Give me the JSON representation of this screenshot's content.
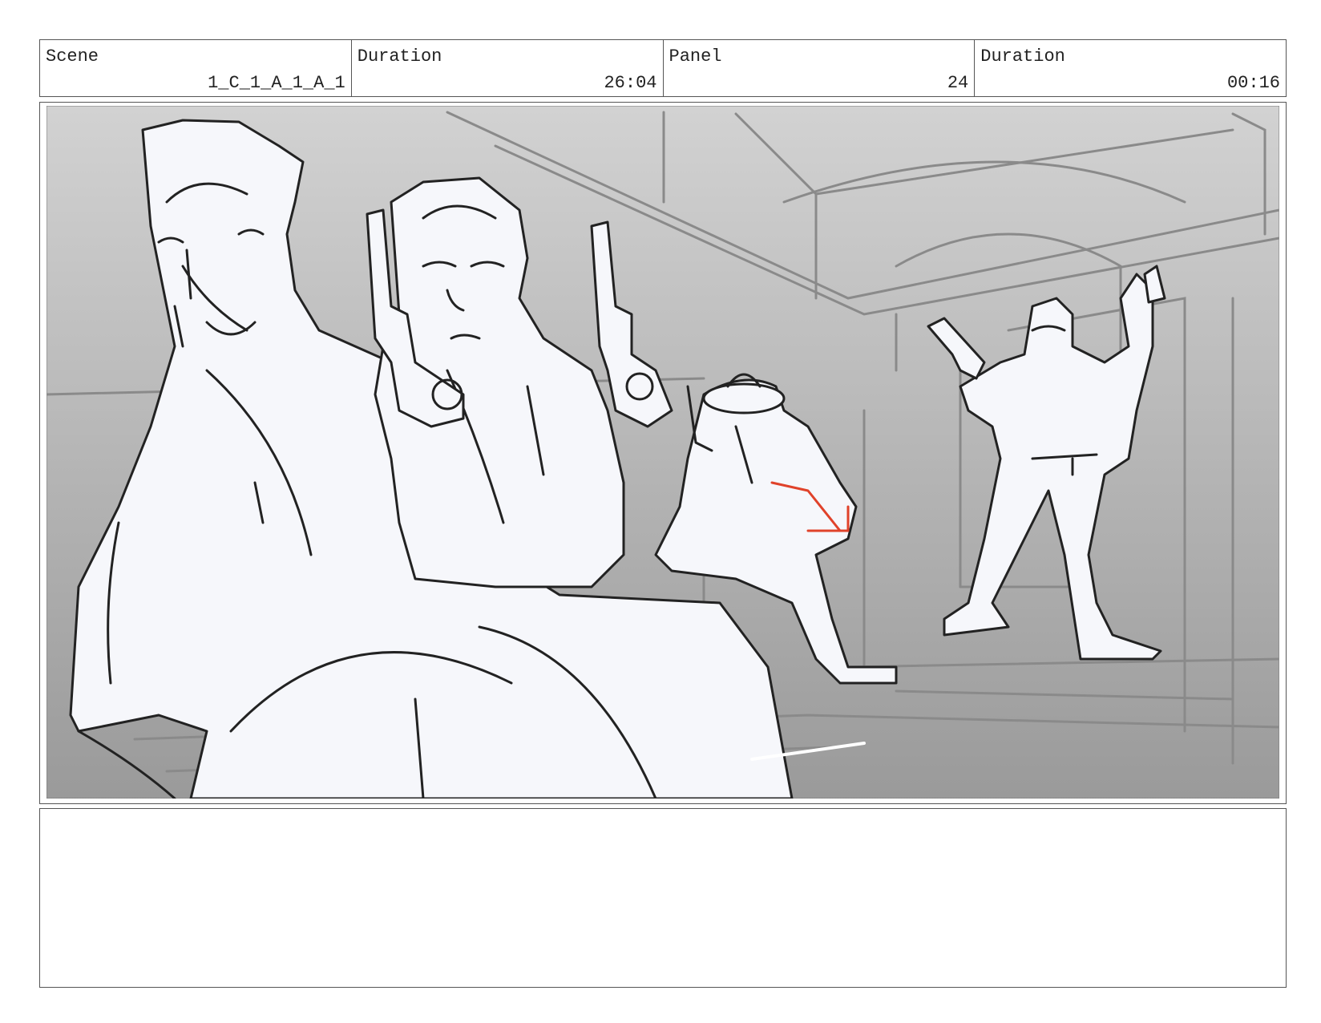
{
  "header": {
    "scene_label": "Scene",
    "scene_value": "1_C_1_A_1_A_1",
    "duration_label": "Duration",
    "duration_value": "26:04",
    "panel_label": "Panel",
    "panel_value": "24",
    "panel_duration_label": "Duration",
    "panel_duration_value": "00:16"
  },
  "frame": {
    "image_description": "rough storyboard sketch"
  },
  "notes": {
    "text": ""
  },
  "colors": {
    "line": "#222222",
    "border": "#555555",
    "background_gradient_top": "#d2d2d2",
    "background_gradient_bottom": "#9a9a9a",
    "accent_red": "#e0422a"
  }
}
